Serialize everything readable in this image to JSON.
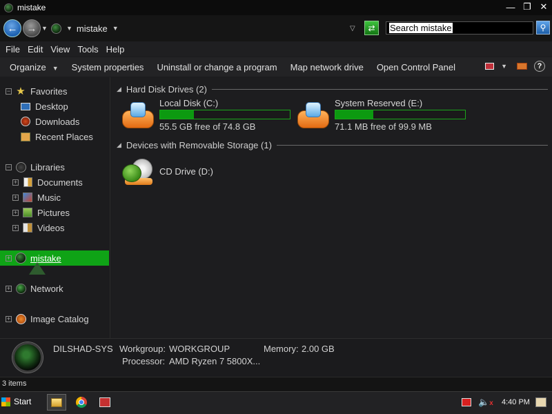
{
  "window": {
    "title": "mistake",
    "controls": [
      "minimize-icon",
      "restore-icon",
      "close-icon"
    ]
  },
  "navbar": {
    "breadcrumb": "mistake",
    "search_placeholder": "Search mistake"
  },
  "menu": [
    "File",
    "Edit",
    "View",
    "Tools",
    "Help"
  ],
  "commands": {
    "organize": "Organize",
    "system_properties": "System properties",
    "uninstall": "Uninstall or change a program",
    "map_drive": "Map network drive",
    "control_panel": "Open Control Panel"
  },
  "sidebar": {
    "favorites": {
      "label": "Favorites",
      "items": [
        "Desktop",
        "Downloads",
        "Recent Places"
      ]
    },
    "libraries": {
      "label": "Libraries",
      "items": [
        "Documents",
        "Music",
        "Pictures",
        "Videos"
      ]
    },
    "computer": "mistake",
    "network": "Network",
    "image_catalog": "Image Catalog"
  },
  "content": {
    "groups": [
      {
        "header": "Hard Disk Drives (2)",
        "drives": [
          {
            "name": "Local Disk (C:)",
            "free_text": "55.5 GB free of 74.8 GB",
            "used_fraction": 0.26
          },
          {
            "name": "System Reserved (E:)",
            "free_text": "71.1 MB free of 99.9 MB",
            "used_fraction": 0.29
          }
        ]
      },
      {
        "header": "Devices with Removable Storage (1)",
        "drives": [
          {
            "name": "CD Drive (D:)"
          }
        ]
      }
    ]
  },
  "details": {
    "computer_name": "DILSHAD-SYS",
    "workgroup_label": "Workgroup:",
    "workgroup_value": "WORKGROUP",
    "memory_label": "Memory:",
    "memory_value": "2.00 GB",
    "processor_label": "Processor:",
    "processor_value": "AMD Ryzen 7 5800X..."
  },
  "status": {
    "items": "3 items"
  },
  "taskbar": {
    "start_label": "Start",
    "clock": "4:40 PM"
  },
  "colors": {
    "selection": "#0fa316",
    "capacity_bar": "#0c9a10",
    "background": "#1c1c1e"
  }
}
